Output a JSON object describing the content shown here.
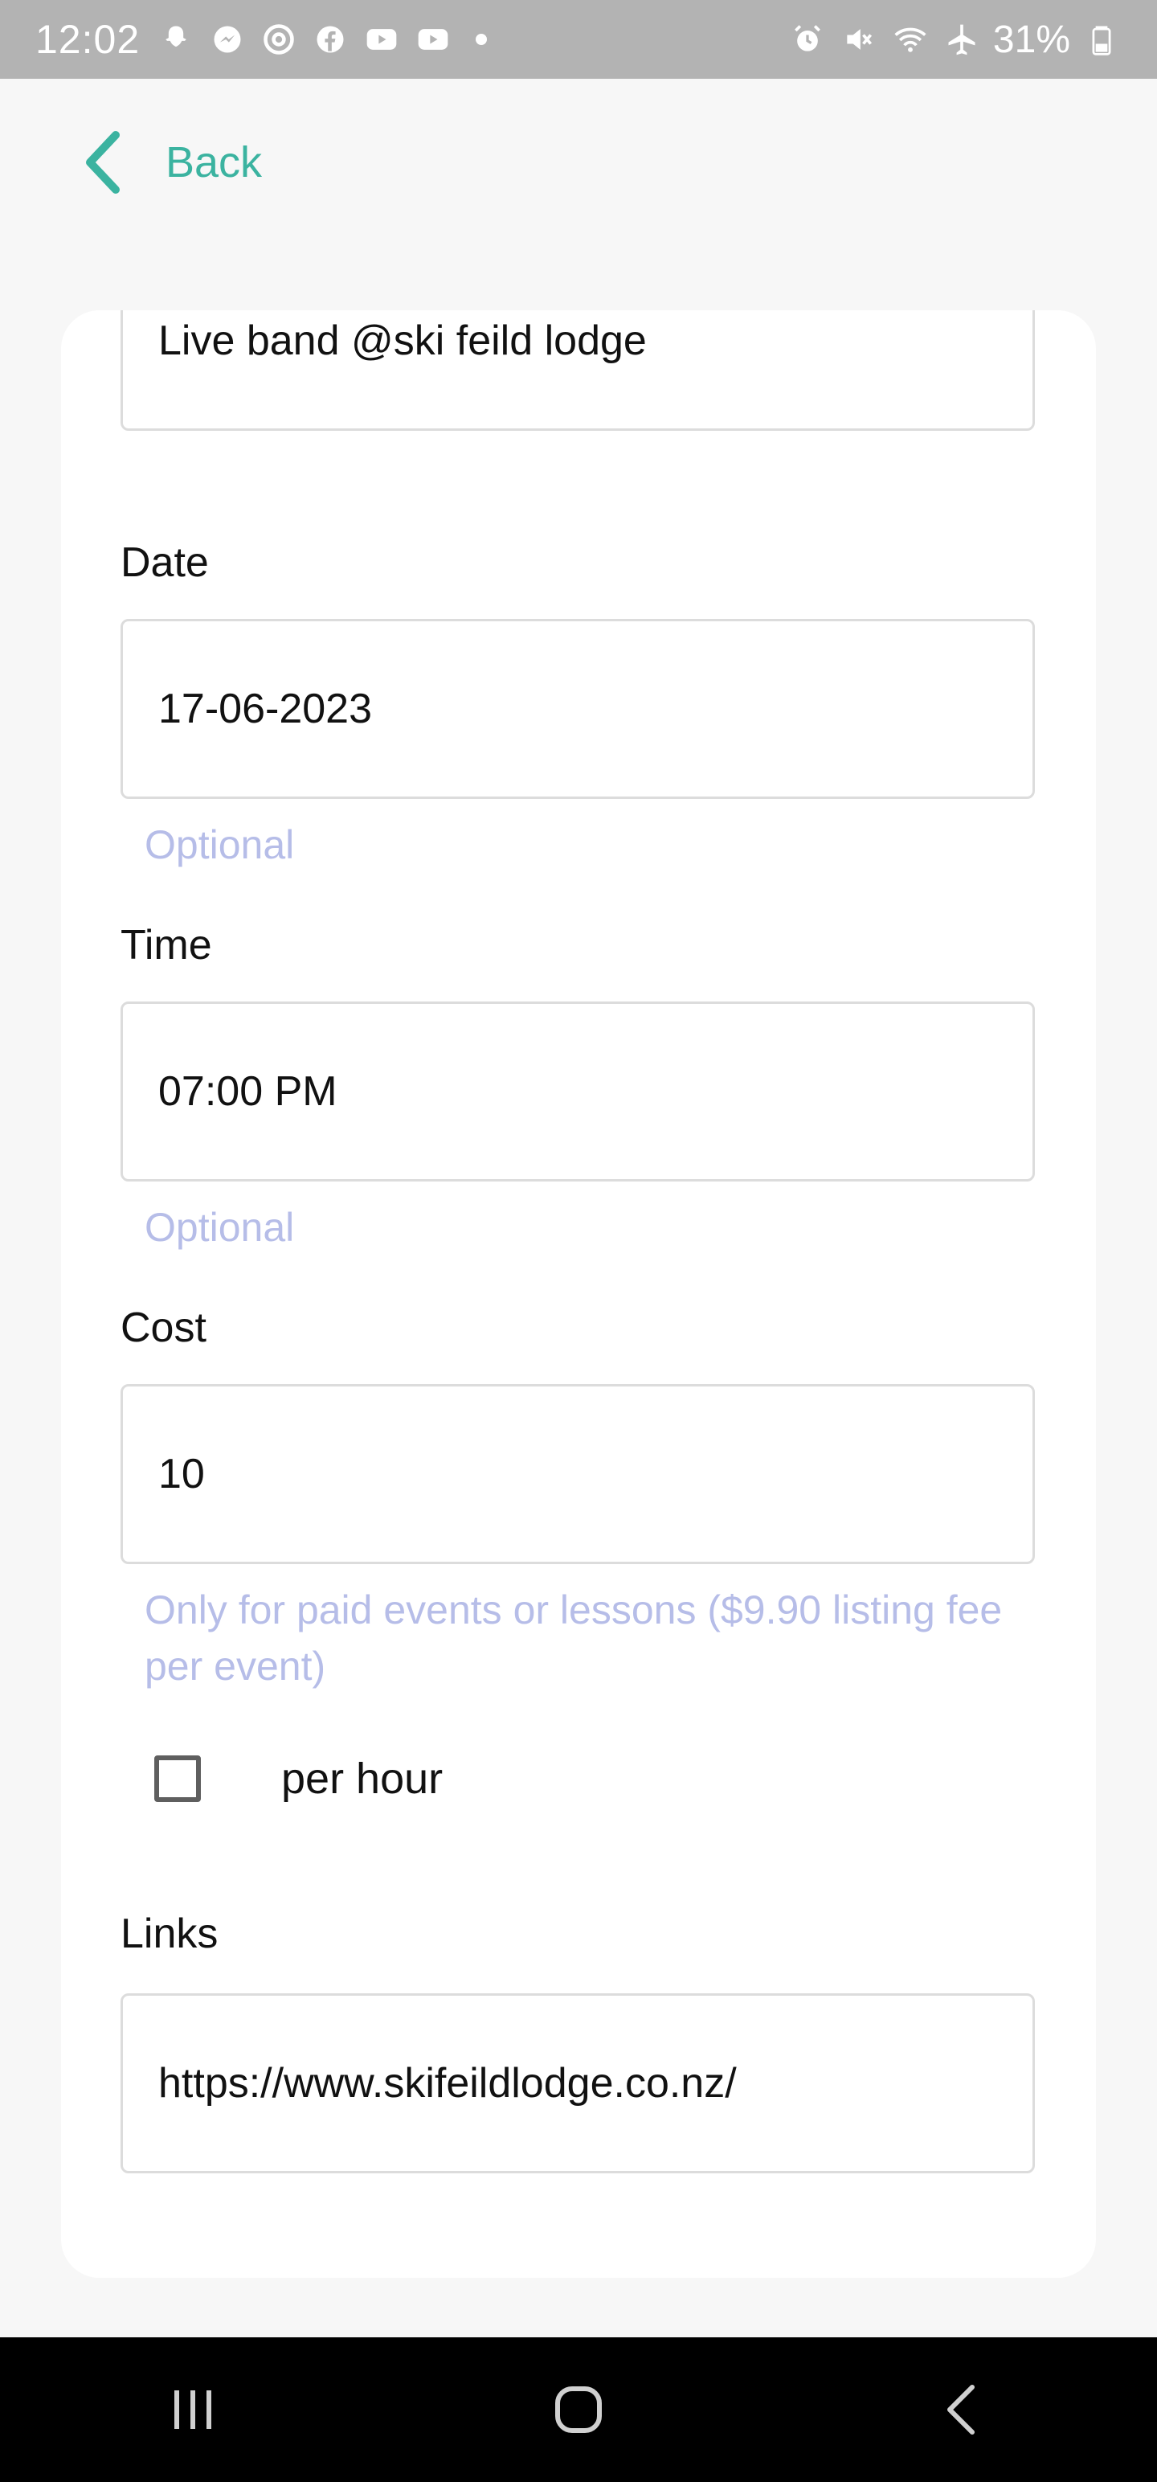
{
  "status_bar": {
    "time": "12:02",
    "battery": "31%",
    "left_icons": [
      "snapchat-icon",
      "messenger-icon",
      "chrome-icon",
      "facebook-icon",
      "youtube-icon",
      "youtube-icon"
    ],
    "right_icons": [
      "alarm-icon",
      "mute-icon",
      "wifi-icon",
      "airplane-icon",
      "battery-icon"
    ]
  },
  "header": {
    "back_label": "Back",
    "accent_color": "#3bb3a0"
  },
  "form": {
    "title_value": "Live band @ski feild lodge",
    "date": {
      "label": "Date",
      "value": "17-06-2023",
      "hint": "Optional"
    },
    "time": {
      "label": "Time",
      "value": "07:00 PM",
      "hint": "Optional"
    },
    "cost": {
      "label": "Cost",
      "value": "10",
      "hint": "Only for paid events or lessons ($9.90 listing fee per event)"
    },
    "per_hour": {
      "label": "per hour",
      "checked": false
    },
    "links": {
      "label": "Links",
      "value": "https://www.skifeildlodge.co.nz/"
    }
  },
  "nav": {
    "buttons": [
      "recent-apps-icon",
      "home-icon",
      "back-icon"
    ]
  }
}
